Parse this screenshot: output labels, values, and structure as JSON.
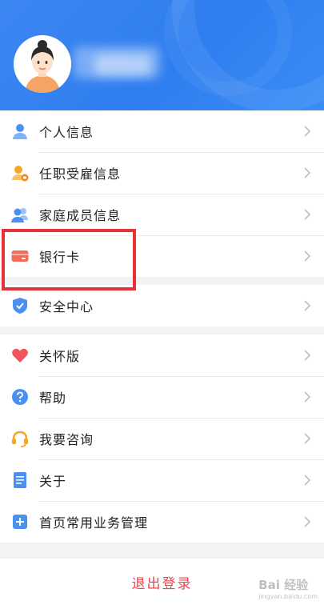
{
  "colors": {
    "header": "#2f7ef0",
    "logout": "#f0454f",
    "highlight": "#e63339"
  },
  "groups": [
    {
      "items": [
        {
          "label": "个人信息",
          "icon": "person-icon"
        },
        {
          "label": "任职受雇信息",
          "icon": "employment-icon"
        },
        {
          "label": "家庭成员信息",
          "icon": "family-icon"
        },
        {
          "label": "银行卡",
          "icon": "bank-card-icon"
        }
      ]
    },
    {
      "items": [
        {
          "label": "安全中心",
          "icon": "shield-icon"
        }
      ]
    },
    {
      "items": [
        {
          "label": "关怀版",
          "icon": "heart-icon"
        },
        {
          "label": "帮助",
          "icon": "help-icon"
        },
        {
          "label": "我要咨询",
          "icon": "headset-icon"
        },
        {
          "label": "关于",
          "icon": "document-icon"
        },
        {
          "label": "首页常用业务管理",
          "icon": "plus-square-icon"
        }
      ]
    }
  ],
  "logout_label": "退出登录",
  "watermark": {
    "text": "Bai 经验",
    "sub": "jingyan.baidu.com"
  }
}
